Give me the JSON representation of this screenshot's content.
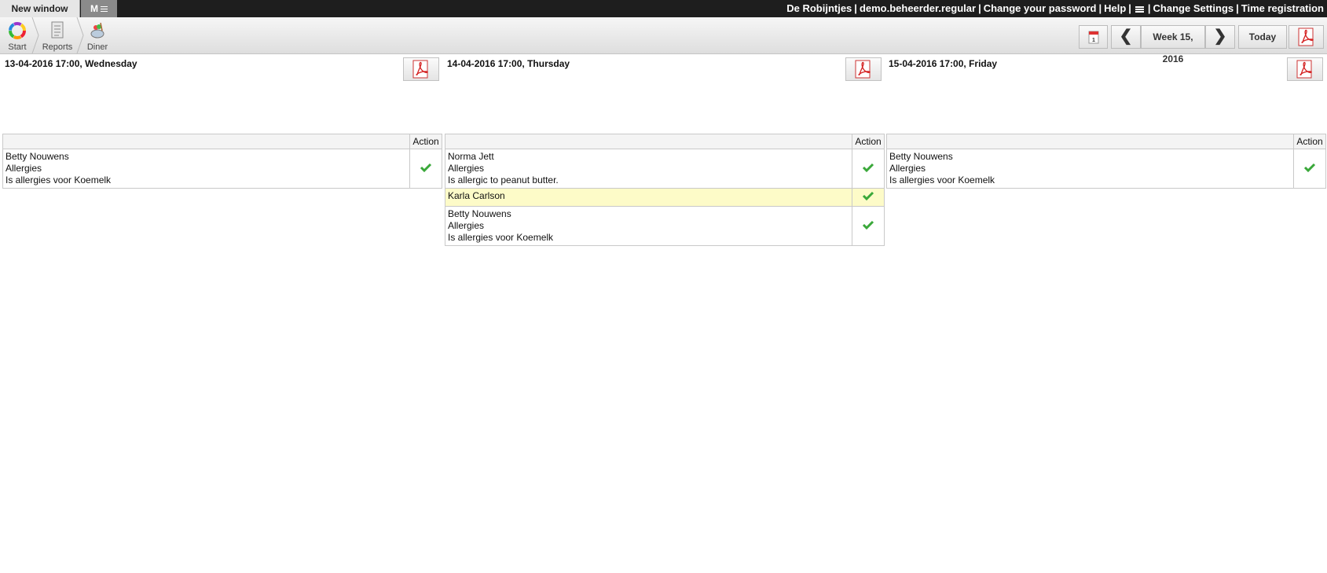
{
  "topbar": {
    "tab_new_window": "New window",
    "tab_m": "M",
    "links": [
      "De Robijntjes",
      "demo.beheerder.regular",
      "Change your password",
      "Help",
      "Change Settings",
      "Time registration"
    ]
  },
  "toolbar": {
    "crumbs": [
      {
        "label": "Start",
        "icon": "start-icon"
      },
      {
        "label": "Reports",
        "icon": "reports-icon"
      },
      {
        "label": "Diner",
        "icon": "diner-icon"
      }
    ],
    "week_label": "Week 15, 2016",
    "today_label": "Today"
  },
  "days": [
    {
      "title": "13-04-2016 17:00, Wednesday",
      "action_header": "Action",
      "rows": [
        {
          "name": "Betty Nouwens",
          "category": "Allergies",
          "note": "Is allergies voor Koemelk",
          "highlight": false
        }
      ]
    },
    {
      "title": "14-04-2016 17:00, Thursday",
      "action_header": "Action",
      "rows": [
        {
          "name": "Norma Jett",
          "category": "Allergies",
          "note": "Is allergic to peanut butter.",
          "highlight": false
        },
        {
          "name": "Karla Carlson",
          "category": "",
          "note": "",
          "highlight": true
        },
        {
          "name": "Betty Nouwens",
          "category": "Allergies",
          "note": "Is allergies voor Koemelk",
          "highlight": false
        }
      ]
    },
    {
      "title": "15-04-2016 17:00, Friday",
      "action_header": "Action",
      "rows": [
        {
          "name": "Betty Nouwens",
          "category": "Allergies",
          "note": "Is allergies voor Koemelk",
          "highlight": false
        }
      ]
    }
  ],
  "colors": {
    "topbar": "#1e1e1e",
    "highlight_row": "#fdfbc8",
    "check": "#3aa83a",
    "pdf_red": "#d42020"
  }
}
